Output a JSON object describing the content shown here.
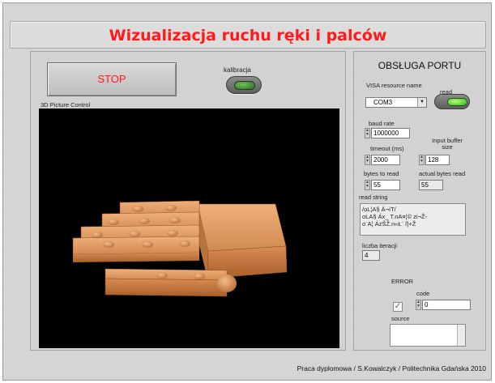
{
  "title": "Wizualizacja ruchu ręki i palców",
  "left": {
    "stop_label": "STOP",
    "calibration_label": "kalibracja",
    "view_label": "3D Picture Control"
  },
  "port": {
    "title": "OBSŁUGA PORTU",
    "visa_label": "VISA resource name",
    "visa_value": "COM3",
    "read_label": "read",
    "baud_label": "baud rate",
    "baud_value": "1000000",
    "timeout_label": "timeout (ms)",
    "timeout_value": "2000",
    "buffer_label": "Input buffer size",
    "buffer_value": "128",
    "bytes_to_read_label": "bytes to read",
    "bytes_to_read_value": "55",
    "actual_bytes_label": "actual bytes read",
    "actual_bytes_value": "55",
    "read_string_label": "read string",
    "read_string_lines": [
      "/oL¦A§ Á¬íT/",
      "oLA§  Áx_ T.nA¤¦© zi¬Ž-",
      "o¨A¦  ÁzŠŽ.n«Ł¨ ľ|+Ž"
    ],
    "iterations_label": "liczba iteracji",
    "iterations_value": "4"
  },
  "error": {
    "title": "ERROR",
    "code_label": "code",
    "code_value": "0",
    "status_check": "✓",
    "source_label": "source"
  },
  "footer": "Praca dyplomowa / S.Kowalczyk / Politechnika Gdańska 2010",
  "colors": {
    "title_red": "#ff1a1a",
    "panel_gray": "#d2d2d2",
    "hand_orange": "#d98b52",
    "led_green": "#2db31a"
  }
}
